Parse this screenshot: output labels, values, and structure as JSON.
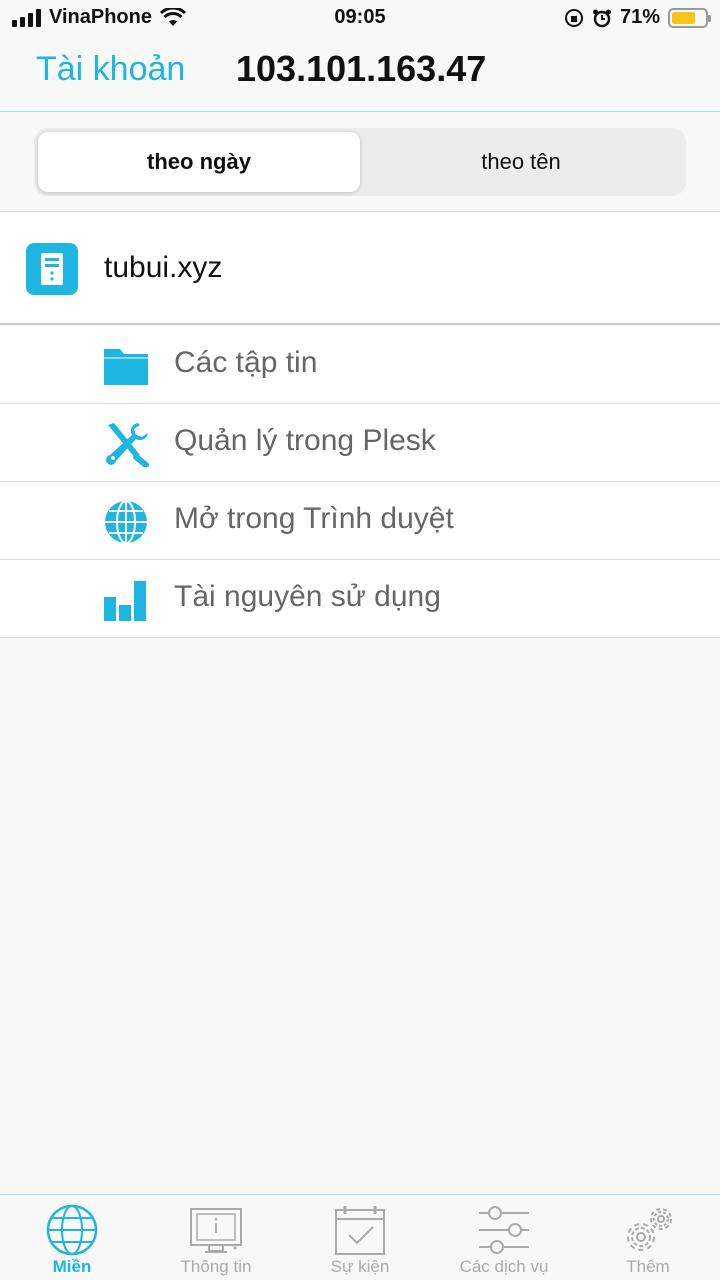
{
  "status": {
    "carrier": "VinaPhone",
    "time": "09:05",
    "battery": "71%",
    "battery_level": 0.71
  },
  "nav": {
    "back_label": "Tài khoản",
    "title": "103.101.163.47"
  },
  "segments": {
    "by_date": "theo ngày",
    "by_name": "theo tên",
    "selected": "theo ngày"
  },
  "domain": {
    "name": "tubui.xyz",
    "icon": "server-icon"
  },
  "menu": {
    "items": [
      {
        "label": "Các tập tin",
        "icon": "folder-icon"
      },
      {
        "label": "Quản lý trong Plesk",
        "icon": "tools-icon"
      },
      {
        "label": "Mở trong Trình duyệt",
        "icon": "globe-icon"
      },
      {
        "label": "Tài nguyên sử dụng",
        "icon": "bar-chart-icon"
      }
    ]
  },
  "tabs": {
    "items": [
      {
        "label": "Miền",
        "icon": "globe-icon",
        "active": true
      },
      {
        "label": "Thông tin",
        "icon": "monitor-icon",
        "active": false
      },
      {
        "label": "Sự kiện",
        "icon": "calendar-check-icon",
        "active": false
      },
      {
        "label": "Các dịch vụ",
        "icon": "sliders-icon",
        "active": false
      },
      {
        "label": "Thêm",
        "icon": "gears-icon",
        "active": false
      }
    ]
  },
  "colors": {
    "accent": "#1eb5e0",
    "battery": "#f5c518"
  }
}
